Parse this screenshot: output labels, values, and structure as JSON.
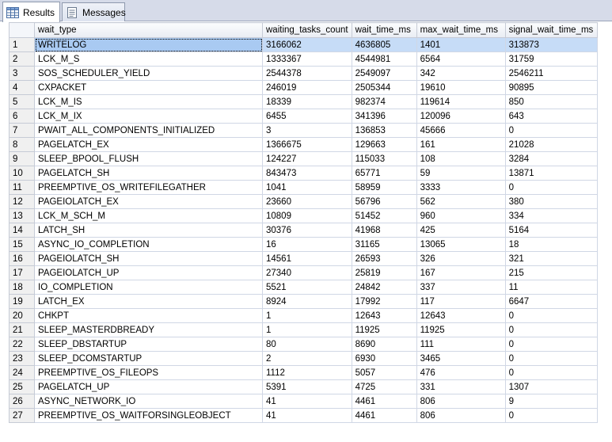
{
  "tabs": [
    {
      "label": "Results",
      "icon": "grid-icon",
      "active": true
    },
    {
      "label": "Messages",
      "icon": "messages-icon",
      "active": false
    }
  ],
  "columns": [
    "wait_type",
    "waiting_tasks_count",
    "wait_time_ms",
    "max_wait_time_ms",
    "signal_wait_time_ms"
  ],
  "rows": [
    [
      "1",
      "WRITELOG",
      "3166062",
      "4636805",
      "1401",
      "313873"
    ],
    [
      "2",
      "LCK_M_S",
      "1333367",
      "4544981",
      "6564",
      "31759"
    ],
    [
      "3",
      "SOS_SCHEDULER_YIELD",
      "2544378",
      "2549097",
      "342",
      "2546211"
    ],
    [
      "4",
      "CXPACKET",
      "246019",
      "2505344",
      "19610",
      "90895"
    ],
    [
      "5",
      "LCK_M_IS",
      "18339",
      "982374",
      "119614",
      "850"
    ],
    [
      "6",
      "LCK_M_IX",
      "6455",
      "341396",
      "120096",
      "643"
    ],
    [
      "7",
      "PWAIT_ALL_COMPONENTS_INITIALIZED",
      "3",
      "136853",
      "45666",
      "0"
    ],
    [
      "8",
      "PAGELATCH_EX",
      "1366675",
      "129663",
      "161",
      "21028"
    ],
    [
      "9",
      "SLEEP_BPOOL_FLUSH",
      "124227",
      "115033",
      "108",
      "3284"
    ],
    [
      "10",
      "PAGELATCH_SH",
      "843473",
      "65771",
      "59",
      "13871"
    ],
    [
      "11",
      "PREEMPTIVE_OS_WRITEFILEGATHER",
      "1041",
      "58959",
      "3333",
      "0"
    ],
    [
      "12",
      "PAGEIOLATCH_EX",
      "23660",
      "56796",
      "562",
      "380"
    ],
    [
      "13",
      "LCK_M_SCH_M",
      "10809",
      "51452",
      "960",
      "334"
    ],
    [
      "14",
      "LATCH_SH",
      "30376",
      "41968",
      "425",
      "5164"
    ],
    [
      "15",
      "ASYNC_IO_COMPLETION",
      "16",
      "31165",
      "13065",
      "18"
    ],
    [
      "16",
      "PAGEIOLATCH_SH",
      "14561",
      "26593",
      "326",
      "321"
    ],
    [
      "17",
      "PAGEIOLATCH_UP",
      "27340",
      "25819",
      "167",
      "215"
    ],
    [
      "18",
      "IO_COMPLETION",
      "5521",
      "24842",
      "337",
      "11"
    ],
    [
      "19",
      "LATCH_EX",
      "8924",
      "17992",
      "117",
      "6647"
    ],
    [
      "20",
      "CHKPT",
      "1",
      "12643",
      "12643",
      "0"
    ],
    [
      "21",
      "SLEEP_MASTERDBREADY",
      "1",
      "11925",
      "11925",
      "0"
    ],
    [
      "22",
      "SLEEP_DBSTARTUP",
      "80",
      "8690",
      "111",
      "0"
    ],
    [
      "23",
      "SLEEP_DCOMSTARTUP",
      "2",
      "6930",
      "3465",
      "0"
    ],
    [
      "24",
      "PREEMPTIVE_OS_FILEOPS",
      "1112",
      "5057",
      "476",
      "0"
    ],
    [
      "25",
      "PAGELATCH_UP",
      "5391",
      "4725",
      "331",
      "1307"
    ],
    [
      "26",
      "ASYNC_NETWORK_IO",
      "41",
      "4461",
      "806",
      "9"
    ],
    [
      "27",
      "PREEMPTIVE_OS_WAITFORSINGLEOBJECT",
      "41",
      "4461",
      "806",
      "0"
    ]
  ],
  "selected_row": 0,
  "colors": {
    "selection": "#c6dcf7",
    "selection_focus": "#a9caf2",
    "tabbar": "#d6dbe9"
  }
}
